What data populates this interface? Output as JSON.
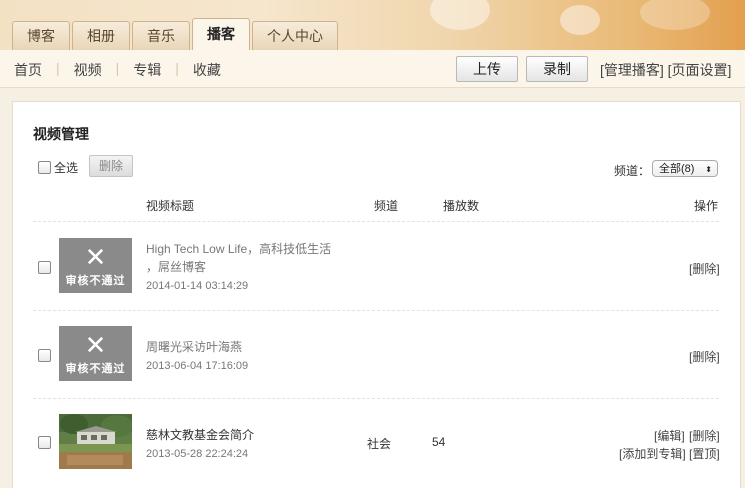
{
  "tabs": [
    "博客",
    "相册",
    "音乐",
    "播客",
    "个人中心"
  ],
  "active_tab": "播客",
  "subnav": {
    "links": [
      "首页",
      "视频",
      "专辑",
      "收藏"
    ],
    "upload": "上传",
    "record": "录制",
    "manage": "[管理播客]",
    "page_settings": "[页面设置]"
  },
  "panel": {
    "title": "视频管理",
    "select_all": "全选",
    "delete": "删除",
    "channel_label": "频道：",
    "channel_value": "全部(8)",
    "columns": {
      "title": "视频标题",
      "channel": "频道",
      "plays": "播放数",
      "ops": "操作"
    }
  },
  "rejected_label": "审核不通过",
  "videos": [
    {
      "title_line1": "High Tech Low Life，高科技低生活",
      "title_line2": "，屌丝博客",
      "date": "2014-01-14 03:14:29",
      "delete": "[删除]"
    },
    {
      "title_line1": "周曙光采访叶海燕",
      "date": "2013-06-04 17:16:09",
      "delete": "[删除]"
    },
    {
      "title_line1": "慈林文教基金会简介",
      "date": "2013-05-28 22:24:24",
      "channel": "社会",
      "plays": "54",
      "edit": "[编辑]",
      "delete": "[删除]",
      "add_album": "[添加到专辑]",
      "pin": "[置顶]"
    }
  ]
}
